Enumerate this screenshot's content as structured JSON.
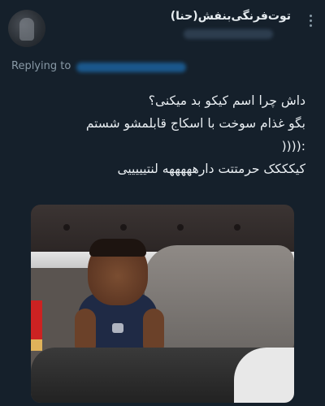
{
  "header": {
    "display_name": "توت‌فرنگی‌بنفش(حنا)",
    "more_icon": "more-vertical-icon"
  },
  "reply": {
    "label": "Replying to"
  },
  "tweet": {
    "lines": [
      "داش چرا اسم کیکو بد میکنی؟",
      "بگو غذام سوخت با اسکاج قابلمشو شستم",
      ":((((",
      "کیکککک حرمتتت دارهههههه لنتیییییی"
    ]
  },
  "colors": {
    "background": "#15202b",
    "text": "#e6ecf0",
    "muted": "#8899a6",
    "link": "#1d9bf0"
  }
}
